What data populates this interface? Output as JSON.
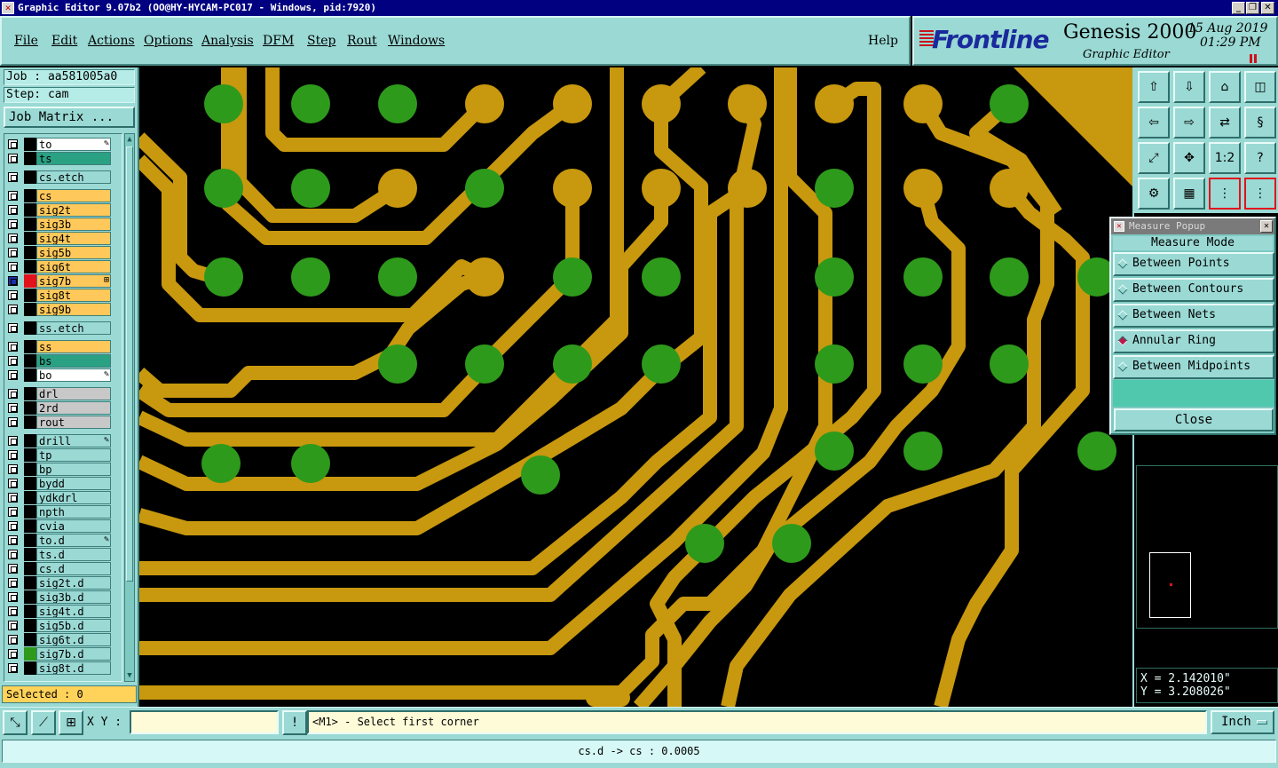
{
  "window": {
    "title": "Graphic Editor 9.07b2 (OO@HY-HYCAM-PC017 - Windows, pid:7920)",
    "controls": [
      "_",
      "❐",
      "✕"
    ]
  },
  "menu": {
    "items": [
      "File",
      "Edit",
      "Actions",
      "Options",
      "Analysis",
      "DFM",
      "Step",
      "Rout",
      "Windows"
    ],
    "help": "Help"
  },
  "brand": {
    "logo": "Frontline",
    "product": "Genesis 2000",
    "subtitle": "Graphic Editor",
    "date": "15 Aug 2019",
    "time": "01:29 PM"
  },
  "left": {
    "job": "Job : aa581005a0",
    "step": "Step: cam",
    "job_matrix": "Job Matrix ...",
    "layers": [
      {
        "name": "to",
        "bg": "#ffffff",
        "marker": "pencil"
      },
      {
        "name": "ts",
        "bg": "#2aa183",
        "marker": ""
      },
      {
        "name": "cs.etch",
        "bg": "#9ad9d4",
        "marker": ""
      },
      {
        "name": "cs",
        "bg": "#ffc85a",
        "marker": ""
      },
      {
        "name": "sig2t",
        "bg": "#ffc85a",
        "marker": ""
      },
      {
        "name": "sig3b",
        "bg": "#ffc85a",
        "marker": ""
      },
      {
        "name": "sig4t",
        "bg": "#ffc85a",
        "marker": ""
      },
      {
        "name": "sig5b",
        "bg": "#ffc85a",
        "marker": ""
      },
      {
        "name": "sig6t",
        "bg": "#ffc85a",
        "marker": ""
      },
      {
        "name": "sig7b",
        "bg": "#ffc85a",
        "marker": "grid",
        "active": true
      },
      {
        "name": "sig8t",
        "bg": "#ffc85a",
        "marker": ""
      },
      {
        "name": "sig9b",
        "bg": "#ffc85a",
        "marker": ""
      },
      {
        "name": "ss.etch",
        "bg": "#9ad9d4",
        "marker": ""
      },
      {
        "name": "ss",
        "bg": "#ffc85a",
        "marker": ""
      },
      {
        "name": "bs",
        "bg": "#2aa183",
        "marker": ""
      },
      {
        "name": "bo",
        "bg": "#ffffff",
        "marker": "pencil"
      },
      {
        "name": "drl",
        "bg": "#c8c8c8",
        "marker": ""
      },
      {
        "name": "2rd",
        "bg": "#c8c8c8",
        "marker": ""
      },
      {
        "name": "rout",
        "bg": "#c8c8c8",
        "marker": ""
      },
      {
        "name": "drill",
        "bg": "#9ad9d4",
        "marker": "pencil"
      },
      {
        "name": "tp",
        "bg": "#9ad9d4",
        "marker": ""
      },
      {
        "name": "bp",
        "bg": "#9ad9d4",
        "marker": ""
      },
      {
        "name": "bydd",
        "bg": "#9ad9d4",
        "marker": ""
      },
      {
        "name": "ydkdrl",
        "bg": "#9ad9d4",
        "marker": ""
      },
      {
        "name": "npth",
        "bg": "#9ad9d4",
        "marker": ""
      },
      {
        "name": "cvia",
        "bg": "#9ad9d4",
        "marker": ""
      },
      {
        "name": "to.d",
        "bg": "#9ad9d4",
        "marker": "pencil"
      },
      {
        "name": "ts.d",
        "bg": "#9ad9d4",
        "marker": ""
      },
      {
        "name": "cs.d",
        "bg": "#9ad9d4",
        "marker": ""
      },
      {
        "name": "sig2t.d",
        "bg": "#9ad9d4",
        "marker": ""
      },
      {
        "name": "sig3b.d",
        "bg": "#9ad9d4",
        "marker": ""
      },
      {
        "name": "sig4t.d",
        "bg": "#9ad9d4",
        "marker": ""
      },
      {
        "name": "sig5b.d",
        "bg": "#9ad9d4",
        "marker": ""
      },
      {
        "name": "sig6t.d",
        "bg": "#9ad9d4",
        "marker": ""
      },
      {
        "name": "sig7b.d",
        "bg": "#9ad9d4",
        "marker": "",
        "swatch": "#2e9a1c"
      },
      {
        "name": "sig8t.d",
        "bg": "#9ad9d4",
        "marker": ""
      }
    ],
    "selected": "Selected : 0"
  },
  "popup": {
    "title": "Measure Popup",
    "mode_label": "Measure Mode",
    "options": [
      {
        "label": "Between Points",
        "on": false
      },
      {
        "label": "Between Contours",
        "on": false
      },
      {
        "label": "Between Nets",
        "on": false
      },
      {
        "label": "Annular Ring",
        "on": true
      },
      {
        "label": "Between Midpoints",
        "on": false
      }
    ],
    "close": "Close"
  },
  "tools": [
    "home-up-icon",
    "down-arrow-icon",
    "home-icon",
    "split-icon",
    "left-arrow-icon",
    "right-arrow-icon",
    "swap-icon",
    "snake-icon",
    "fit-icon",
    "pan-icon",
    "ratio-icon",
    "help-icon",
    "settings-icon",
    "grid-icon",
    "layers-a-icon",
    "layers-b-icon"
  ],
  "tool_labels": {
    "ratio": "1:2",
    "help": "?"
  },
  "coords": {
    "x": "X = 2.142010\"",
    "y": "Y = 3.208026\""
  },
  "command": {
    "xy_label": "X Y :",
    "xy_value": "",
    "bang": "!",
    "prompt": "<M1> - Select first corner",
    "unit": "Inch"
  },
  "status": "cs.d -> cs : 0.0005",
  "colors": {
    "copper": "#c8980e",
    "pad": "#2e9a1c",
    "panel": "#9ad9d4"
  }
}
